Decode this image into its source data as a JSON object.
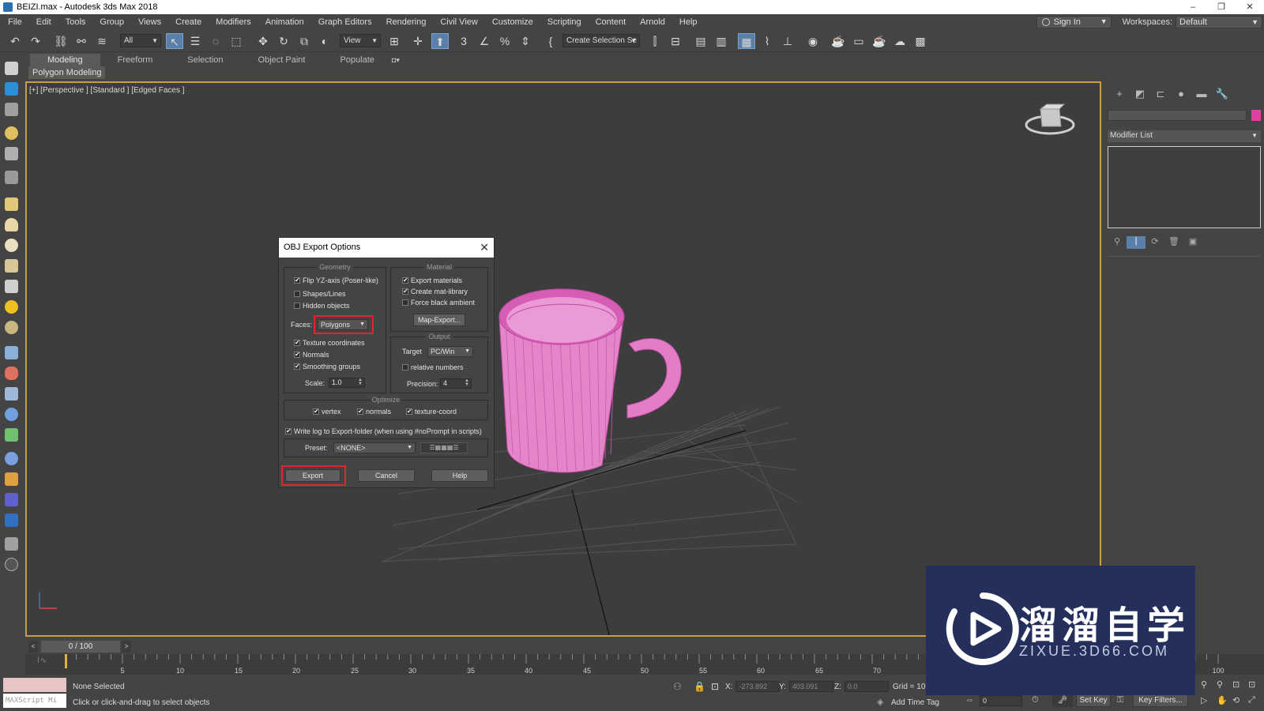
{
  "window": {
    "title": "BEIZI.max - Autodesk 3ds Max 2018",
    "controls": [
      "–",
      "❐",
      "✕"
    ]
  },
  "menubar": {
    "items": [
      "File",
      "Edit",
      "Tools",
      "Group",
      "Views",
      "Create",
      "Modifiers",
      "Animation",
      "Graph Editors",
      "Rendering",
      "Civil View",
      "Customize",
      "Scripting",
      "Content",
      "Arnold",
      "Help"
    ],
    "sign_in": "Sign In",
    "workspaces_label": "Workspaces:",
    "workspaces_value": "Default"
  },
  "toolbar": {
    "filter_value": "All",
    "refcoord_value": "View",
    "selection_set_value": "Create Selection Se"
  },
  "ribbon": {
    "tabs": [
      "Modeling",
      "Freeform",
      "Selection",
      "Object Paint",
      "Populate"
    ],
    "active_tab": "Modeling",
    "panel_label": "Polygon Modeling"
  },
  "viewport": {
    "label": "[+] [Perspective ] [Standard ] [Edged Faces ]"
  },
  "command_panel": {
    "modifier_list": "Modifier List",
    "object_color": "#e040a0"
  },
  "dialog": {
    "title": "OBJ Export Options",
    "geometry": {
      "title": "Geometry",
      "flip_yz": {
        "label": "Flip YZ-axis (Poser-like)",
        "checked": true
      },
      "shapes_lines": {
        "label": "Shapes/Lines",
        "checked": false
      },
      "hidden_objects": {
        "label": "Hidden objects",
        "checked": false
      },
      "faces_label": "Faces:",
      "faces_value": "Polygons",
      "texture_coords": {
        "label": "Texture coordinates",
        "checked": true
      },
      "normals": {
        "label": "Normals",
        "checked": true
      },
      "smoothing_groups": {
        "label": "Smoothing groups",
        "checked": true
      },
      "scale_label": "Scale:",
      "scale_value": "1.0"
    },
    "material": {
      "title": "Material",
      "export_materials": {
        "label": "Export materials",
        "checked": true
      },
      "create_mat_library": {
        "label": "Create mat-library",
        "checked": true
      },
      "force_black_ambient": {
        "label": "Force black ambient",
        "checked": false
      },
      "map_export_button": "Map-Export..."
    },
    "output": {
      "title": "Output",
      "target_label": "Target",
      "target_value": "PC/Win",
      "relative_numbers": {
        "label": "relative numbers",
        "checked": false
      },
      "precision_label": "Precision:",
      "precision_value": "4"
    },
    "optimize": {
      "title": "Optimize",
      "vertex": {
        "label": "vertex",
        "checked": true
      },
      "normals": {
        "label": "normals",
        "checked": true
      },
      "texture_coord": {
        "label": "texture-coord",
        "checked": true
      }
    },
    "write_log": {
      "label": "Write log to Export-folder (when using #noPrompt in scripts)",
      "checked": true
    },
    "preset_label": "Preset:",
    "preset_value": "<NONE>",
    "export_button": "Export",
    "cancel_button": "Cancel",
    "help_button": "Help",
    "highlight_color": "#e0262a"
  },
  "timeline": {
    "frame_display": "0 / 100",
    "tick_labels": [
      "5",
      "10",
      "15",
      "20",
      "25",
      "30",
      "35",
      "40",
      "45",
      "50",
      "55",
      "60",
      "65",
      "70",
      "100"
    ]
  },
  "statusbar": {
    "maxscript_placeholder": "MAXScript Mi",
    "selection_status": "None Selected",
    "prompt": "Click or click-and-drag to select objects",
    "x_label": "X:",
    "x_value": "-273.892",
    "y_label": "Y:",
    "y_value": "403.091",
    "z_label": "Z:",
    "z_value": "0.0",
    "grid": "Grid = 10.0",
    "add_time_tag": "Add Time Tag",
    "frame_field": "0",
    "set_key": "Set Key",
    "key_filters": "Key Filters..."
  },
  "watermark": {
    "brand_cn": "溜溜自学",
    "url": "ZIXUE.3D66.COM",
    "color": "#252f5c"
  }
}
